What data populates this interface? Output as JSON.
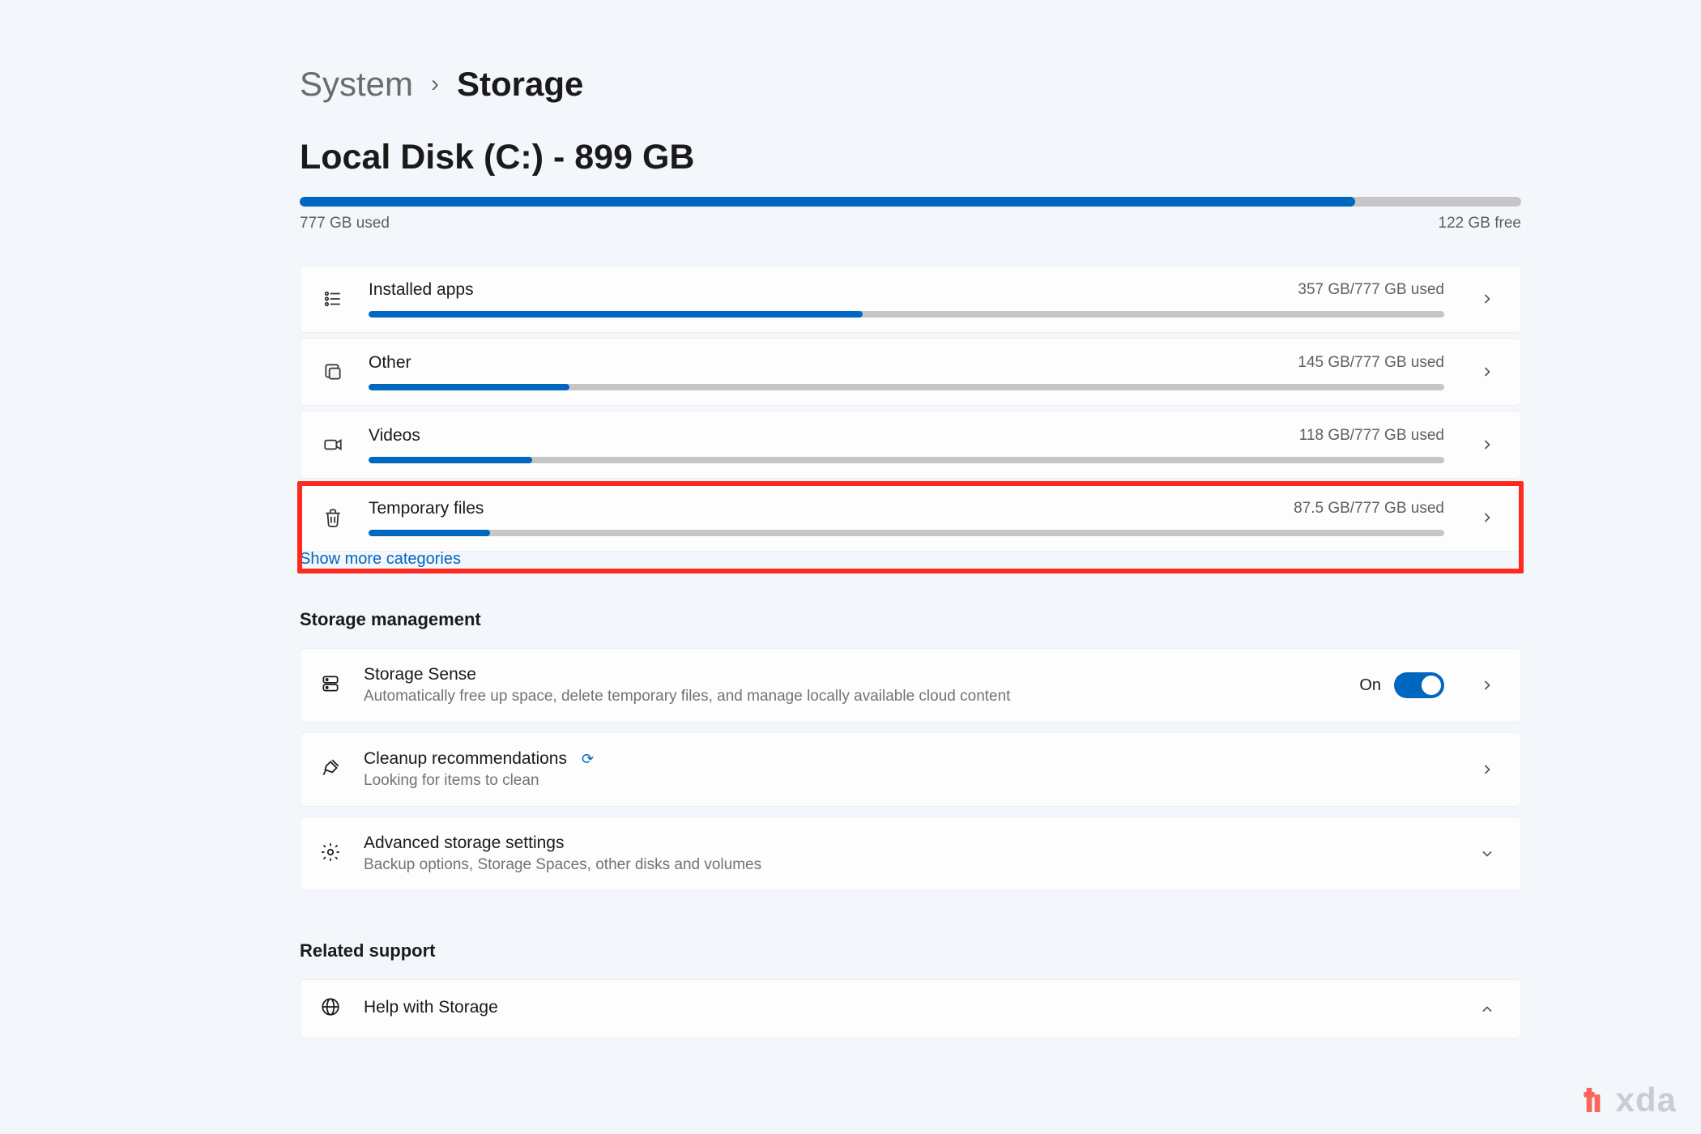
{
  "breadcrumb": {
    "parent": "System",
    "separator": "›",
    "current": "Storage"
  },
  "disk": {
    "title": "Local Disk (C:) - 899 GB",
    "used_label": "777 GB used",
    "free_label": "122 GB free",
    "used_pct": 86.4
  },
  "categories": [
    {
      "key": "installed-apps",
      "icon": "apps-list-icon",
      "label": "Installed apps",
      "usage": "357 GB/777 GB used",
      "pct": 45.9
    },
    {
      "key": "other",
      "icon": "folder-other-icon",
      "label": "Other",
      "usage": "145 GB/777 GB used",
      "pct": 18.7
    },
    {
      "key": "videos",
      "icon": "video-icon",
      "label": "Videos",
      "usage": "118 GB/777 GB used",
      "pct": 15.2
    },
    {
      "key": "temporary-files",
      "icon": "trash-icon",
      "label": "Temporary files",
      "usage": "87.5 GB/777 GB used",
      "pct": 11.3,
      "highlighted": true
    }
  ],
  "show_more": "Show more categories",
  "sections": {
    "management_title": "Storage management",
    "related_title": "Related support"
  },
  "management": [
    {
      "key": "storage-sense",
      "icon": "drive-icon",
      "title": "Storage Sense",
      "subtitle": "Automatically free up space, delete temporary files, and manage locally available cloud content",
      "toggle_state": "On",
      "action": "chevron-right"
    },
    {
      "key": "cleanup-recommendations",
      "icon": "broom-icon",
      "title": "Cleanup recommendations",
      "subtitle": "Looking for items to clean",
      "loading": true,
      "action": "chevron-right"
    },
    {
      "key": "advanced-storage",
      "icon": "gear-icon",
      "title": "Advanced storage settings",
      "subtitle": "Backup options, Storage Spaces, other disks and volumes",
      "action": "chevron-down"
    }
  ],
  "related": [
    {
      "key": "help-storage",
      "icon": "globe-icon",
      "title": "Help with Storage",
      "action": "chevron-up"
    }
  ],
  "chart_data": {
    "type": "bar",
    "title": "Local Disk (C:) - 899 GB",
    "total_gb": 899,
    "used_gb": 777,
    "free_gb": 122,
    "per_category_denominator_gb": 777,
    "series": [
      {
        "name": "Installed apps",
        "value_gb": 357
      },
      {
        "name": "Other",
        "value_gb": 145
      },
      {
        "name": "Videos",
        "value_gb": 118
      },
      {
        "name": "Temporary files",
        "value_gb": 87.5
      }
    ]
  },
  "watermark": "xda"
}
